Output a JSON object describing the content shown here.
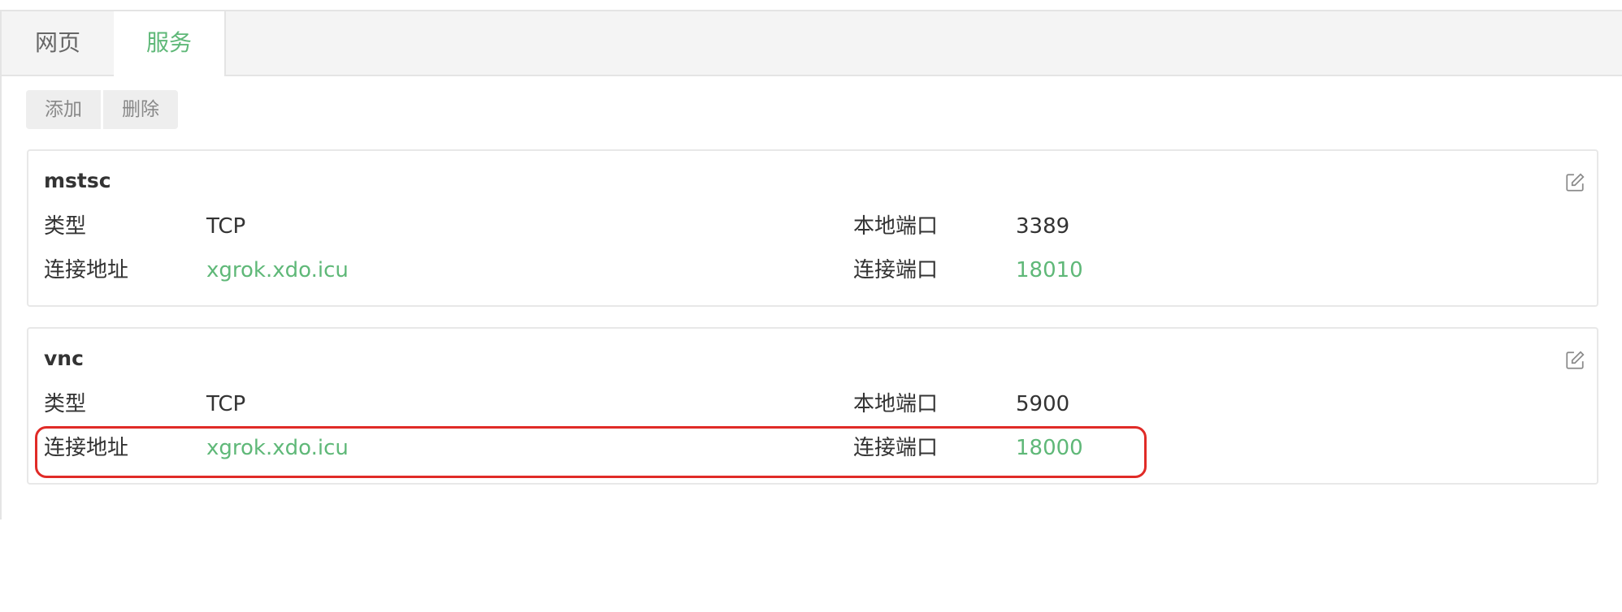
{
  "tabs": [
    {
      "label": "网页",
      "active": false
    },
    {
      "label": "服务",
      "active": true
    }
  ],
  "toolbar": {
    "add_label": "添加",
    "delete_label": "删除"
  },
  "services": [
    {
      "name": "mstsc",
      "type_label": "类型",
      "type_value": "TCP",
      "local_port_label": "本地端口",
      "local_port_value": "3389",
      "address_label": "连接地址",
      "address_value": "xgrok.xdo.icu",
      "remote_port_label": "连接端口",
      "remote_port_value": "18010",
      "edit_icon": "edit-icon"
    },
    {
      "name": "vnc",
      "type_label": "类型",
      "type_value": "TCP",
      "local_port_label": "本地端口",
      "local_port_value": "5900",
      "address_label": "连接地址",
      "address_value": "xgrok.xdo.icu",
      "remote_port_label": "连接端口",
      "remote_port_value": "18000",
      "edit_icon": "edit-icon"
    }
  ],
  "colors": {
    "accent": "#5FB878",
    "highlight": "#e02b27"
  }
}
